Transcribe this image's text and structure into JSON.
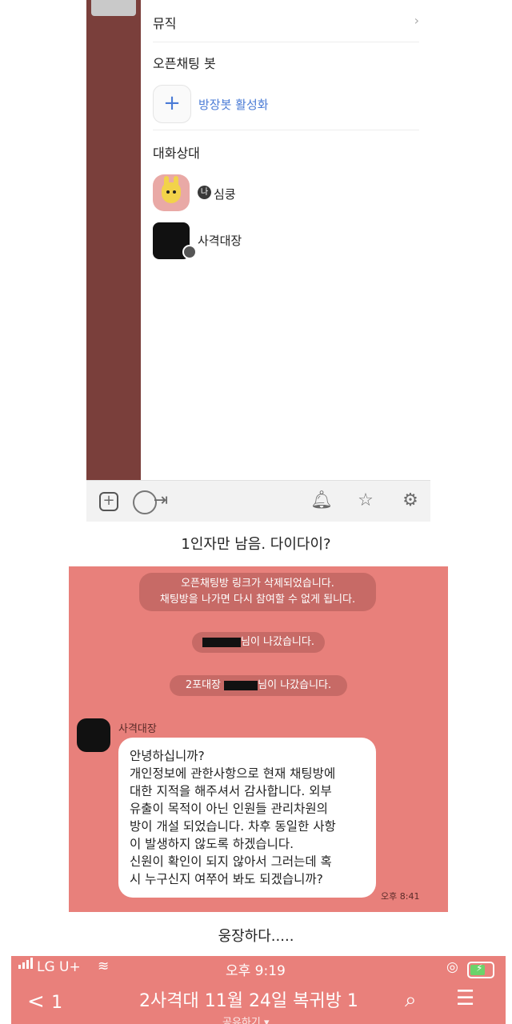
{
  "drawer": {
    "music_label": "뮤직",
    "openchat_bot_heading": "오픈채팅 봇",
    "add_bot_label": "방장봇 활성화",
    "participants_heading": "대화상대",
    "me_badge": "나",
    "participants": [
      {
        "name": "심쿵"
      },
      {
        "name": "사격대장"
      }
    ]
  },
  "caption1": "1인자만 남음. 다이다이?",
  "chat": {
    "system_messages": {
      "link_deleted_line1": "오픈채팅방 링크가 삭제되었습니다.",
      "link_deleted_line2": "채팅방을 나가면 다시 참여할 수 없게 됩니다.",
      "left1_suffix": "님이 나갔습니다.",
      "left2_prefix": "2포대장",
      "left2_suffix": "님이 나갔습니다."
    },
    "sender": "사격대장",
    "message_lines": [
      "안녕하십니까?",
      "개인정보에 관한사항으로 현재 채팅방에",
      "대한 지적을 해주셔서  감사합니다. 외부",
      "유출이 목적이 아닌 인원들 관리차원의",
      "방이 개설 되었습니다. 차후 동일한 사항",
      "이 발생하지 않도록 하겠습니다.",
      "신원이 확인이 되지 않아서 그러는데 혹",
      "시 누구신지 여쭈어 봐도 되겠습니까?"
    ],
    "time": "오후 8:41"
  },
  "caption2": "웅장하다.....",
  "header": {
    "carrier": "LG U+",
    "clock": "오후 9:19",
    "back_count": "1",
    "room_title": "2사격대 11월 24일 복귀방 1",
    "subtitle": "공유하기 ▾"
  },
  "colors": {
    "chat_bg": "#e8807b",
    "link_blue": "#4a7bd6",
    "drawer_strip": "#7a3f3b"
  }
}
